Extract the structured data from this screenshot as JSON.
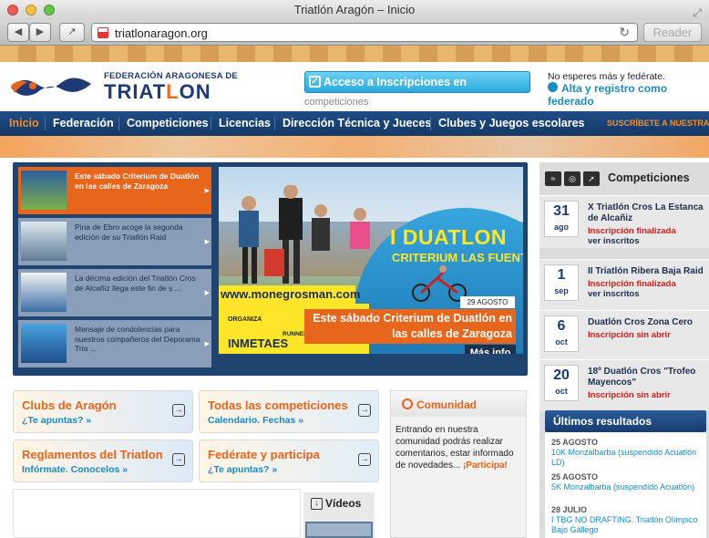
{
  "window": {
    "title": "Triatlón Aragón – Inicio"
  },
  "browser": {
    "url": "triatlonaragon.org",
    "reader_label": "Reader"
  },
  "header": {
    "federation_line": "FEDERACIÓN ARAGONESA DE",
    "logo_word_a": "TRIAT",
    "logo_word_b": "L",
    "logo_word_c": "ON",
    "inscriptions_button": "Acceso a Inscripciones en",
    "inscriptions_sub": "competiciones",
    "promo_text": "No esperes más y fedérate.",
    "register_link": "Alta y registro como federado"
  },
  "nav": {
    "items": [
      "Inicio",
      "Federación",
      "Competiciones",
      "Licencias",
      "Dirección Técnica y Jueces",
      "Clubes y Juegos escolares"
    ],
    "subscribe": "SUSCRÍBETE A NUESTRAS R"
  },
  "slider": {
    "items": [
      {
        "text": "Este sábado Criterium de Duatlón en las calles de Zaragoza"
      },
      {
        "text": "Pina de Ebro acoge la segunda edición de su Triatlón Raid"
      },
      {
        "text": "La décima edición del Triatlón Cros de Alcañiz llega este fin de s ..."
      },
      {
        "text": "Mensaje de condolencias para nuestros compañeros del Deporama Tria ..."
      }
    ],
    "poster_title": "I DUATLON",
    "poster_subtitle": "CRITERIUM LAS FUENTE",
    "poster_web": "www.monegrosman.com",
    "poster_organiza": "ORGANIZA",
    "poster_runner": "RUNNER",
    "poster_sponsor": "INMETAES",
    "date_tag": "29 AGOSTO",
    "caption": "Este sábado Criterium de Duatlón en las calles de Zaragoza",
    "more": "Más info"
  },
  "boxes": [
    {
      "title": "Clubs de Aragón",
      "sub": "¿Te apuntas? »"
    },
    {
      "title": "Todas las competiciones",
      "sub": "Calendario. Fechas »"
    },
    {
      "title": "Reglamentos del Triatlon",
      "sub": "Infórmate. Conocelos »"
    },
    {
      "title": "Fedérate y participa",
      "sub": "¿Te apuntas? »"
    }
  ],
  "comunidad": {
    "title": "Comunidad",
    "text": "Entrando en nuestra comunidad podrás realizar comentarios, estar informado de novedades... ",
    "cta": "¡Participa!"
  },
  "videos": {
    "title": "Vídeos"
  },
  "competiciones": {
    "title": "Competiciones",
    "events": [
      {
        "day": "31",
        "month": "ago",
        "name": "X Triatlón Cros La Estanca de Alcañiz",
        "status": "Inscripción finalizada",
        "link": "ver inscritos"
      },
      {
        "day": "1",
        "month": "sep",
        "name": "II Triatlón Ribera Baja Raid",
        "status": "Inscripción finalizada",
        "link": "ver inscritos"
      },
      {
        "day": "6",
        "month": "oct",
        "name": "Duatlón Cros Zona Cero",
        "status": "Inscripción sin abrir",
        "link": ""
      },
      {
        "day": "20",
        "month": "oct",
        "name": "18º Duatlón Cros \"Trofeo Mayencos\"",
        "status": "Inscripción sin abrir",
        "link": ""
      }
    ]
  },
  "results": {
    "title": "Últimos resultados",
    "items": [
      {
        "date": "25 AGOSTO",
        "link": "10K Monzalbarba (suspendido Acuatlón LD)"
      },
      {
        "date": "25 AGOSTO",
        "link": "5K Monzalbarba (suspendido Acuatlón)"
      },
      {
        "date": "28 JULIO",
        "link": "I TBG NO DRAFTING. Triatlón Olímpico Bajo Gállego"
      }
    ]
  },
  "colors": {
    "accent_orange": "#e8651c",
    "navy": "#1f3b76",
    "link_blue": "#1a8ac2",
    "status_red": "#d0201b"
  }
}
